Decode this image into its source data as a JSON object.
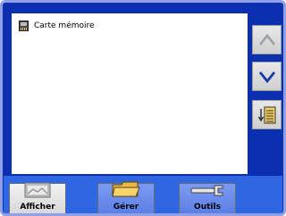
{
  "list": {
    "items": [
      {
        "label": "Carte mémoire",
        "icon": "memory-card-icon"
      }
    ]
  },
  "side_buttons": {
    "up_icon": "chevron-up-icon",
    "down_icon": "chevron-down-icon",
    "sort_icon": "sort-list-icon"
  },
  "tabs": [
    {
      "label": "Afficher",
      "icon": "image-icon",
      "active": true
    },
    {
      "label": "Gérer",
      "icon": "folder-icon",
      "active": false
    },
    {
      "label": "Outils",
      "icon": "wrench-icon",
      "active": false
    }
  ],
  "colors": {
    "background": "#0a2fb0",
    "tab_strip": "#2f66e4",
    "chevron": "#1a3aa8"
  }
}
